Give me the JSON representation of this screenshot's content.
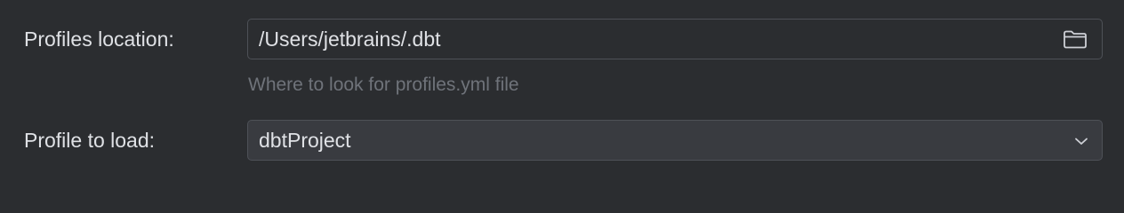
{
  "profiles_location": {
    "label": "Profiles location:",
    "value": "/Users/jetbrains/.dbt",
    "hint": "Where to look for profiles.yml file",
    "icon": "folder-icon"
  },
  "profile_to_load": {
    "label": "Profile to load:",
    "selected": "dbtProject",
    "icon": "chevron-down-icon"
  }
}
